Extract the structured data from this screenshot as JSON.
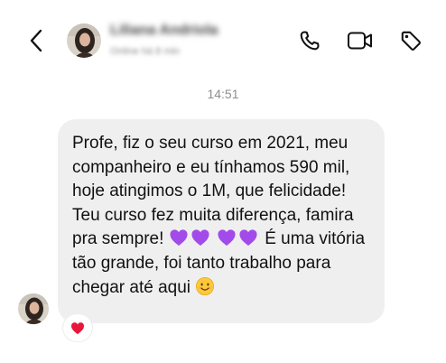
{
  "header": {
    "contact_name": "Liliana Andriola",
    "contact_status": "Online há 8 min"
  },
  "conversation": {
    "timestamp": "14:51",
    "message": {
      "line_1": "Profe, fiz o seu curso em 2021, meu companheiro e eu tínhamos 590 mil, hoje atingimos o 1M, que felicidade! Teu curso fez muita diferença, famira pra sempre!",
      "line_2": "É uma vitória tão grande, foi tanto trabalho para chegar até aqui",
      "emojis": [
        "purple-heart",
        "purple-heart",
        "purple-heart",
        "purple-heart",
        "smiling-face"
      ]
    },
    "reaction": "red-heart"
  },
  "colors": {
    "bubble_bg": "#efeff0",
    "text": "#111111",
    "timestamp": "#8e8e93",
    "purple_heart": "#a34bea",
    "red_heart": "#e8173b"
  }
}
